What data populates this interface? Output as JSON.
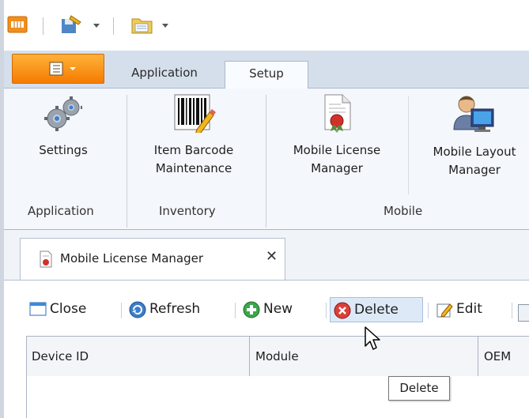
{
  "ribbon_tabs": {
    "application": "Application",
    "setup": "Setup"
  },
  "ribbon": {
    "buttons": {
      "settings": "Settings",
      "item_barcode_line1": "Item Barcode",
      "item_barcode_line2": "Maintenance",
      "mobile_license_line1": "Mobile License",
      "mobile_license_line2": "Manager",
      "mobile_layout_line1": "Mobile Layout",
      "mobile_layout_line2": "Manager"
    },
    "groups": {
      "application": "Application",
      "inventory": "Inventory",
      "mobile": "Mobile"
    }
  },
  "document_tab": {
    "title": "Mobile License Manager"
  },
  "toolbar": {
    "close": "Close",
    "refresh": "Refresh",
    "new": "New",
    "delete": "Delete",
    "edit": "Edit"
  },
  "grid": {
    "columns": [
      "Device ID",
      "Module",
      "OEM"
    ]
  },
  "tooltip": {
    "text": "Delete"
  },
  "colors": {
    "app_menu": "#f57b00",
    "ribbon_tab_bar": "#d5dfec",
    "ribbon_panel": "#f4f7fb",
    "hover_highlight": "#dde9f7"
  }
}
